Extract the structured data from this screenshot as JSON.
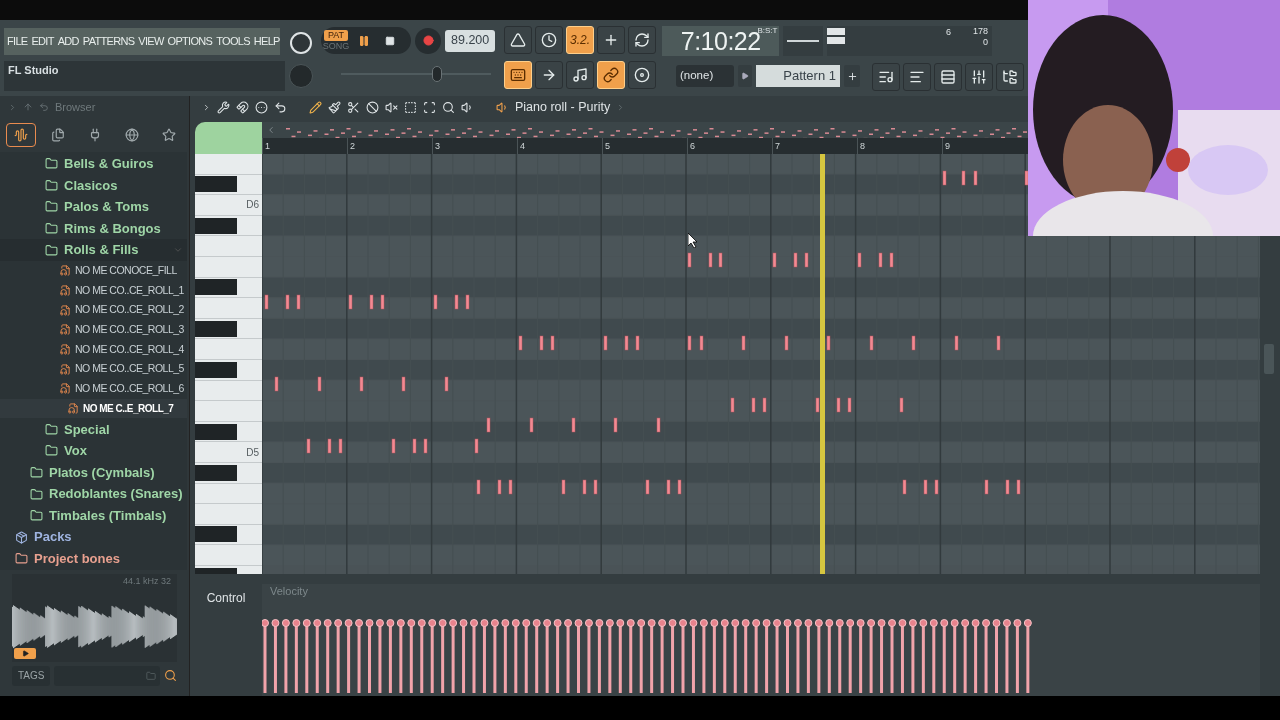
{
  "menu": [
    "FILE",
    "EDIT",
    "ADD",
    "PATTERNS",
    "VIEW",
    "OPTIONS",
    "TOOLS",
    "HELP"
  ],
  "hint": "FL Studio",
  "pitch": {
    "level": 0.65
  },
  "transport": {
    "modes": [
      {
        "label": "PAT",
        "selected": true
      },
      {
        "label": "SONG",
        "selected": false
      }
    ],
    "playing": true,
    "recording": false,
    "tempo": "89.200"
  },
  "time": {
    "value": "7:10:22",
    "unit": "B:S:T"
  },
  "tool_buttons_top": [
    {
      "kind": "metronome",
      "on": false
    },
    {
      "kind": "wait",
      "on": false
    },
    {
      "kind": "countdown",
      "label": "3.2.",
      "on": true
    },
    {
      "kind": "overdub",
      "on": false
    },
    {
      "kind": "loop",
      "on": false
    }
  ],
  "tool_buttons_bottom": [
    {
      "kind": "typing",
      "on": true
    },
    {
      "kind": "step",
      "on": false
    },
    {
      "kind": "note",
      "on": false
    },
    {
      "kind": "link",
      "on": true
    },
    {
      "kind": "knob",
      "on": false
    }
  ],
  "pattern_picker": {
    "arrangement": "(none)",
    "pattern": "Pattern 1"
  },
  "readouts": [
    "6",
    "178",
    "0"
  ],
  "window_buttons": [
    {
      "kind": "playlist"
    },
    {
      "kind": "piano_roll"
    },
    {
      "kind": "channel_rack"
    },
    {
      "kind": "mixer"
    },
    {
      "kind": "browser"
    }
  ],
  "browser": {
    "title": "Browser",
    "tabs": [
      {
        "kind": "all",
        "selected": true
      },
      {
        "kind": "files",
        "selected": false
      },
      {
        "kind": "plugins",
        "selected": false
      },
      {
        "kind": "online",
        "selected": false
      },
      {
        "kind": "starred",
        "selected": false
      }
    ],
    "tree": [
      {
        "children": [
          {
            "children": [
              {
                "kind": "folder",
                "label": "Bells & Guiros",
                "expanded": false
              },
              {
                "kind": "folder",
                "label": "Clasicos",
                "expanded": false
              },
              {
                "kind": "folder",
                "label": "Palos & Toms",
                "expanded": false
              },
              {
                "kind": "folder",
                "label": "Rims & Bongos",
                "expanded": false
              },
              {
                "kind": "folder",
                "label": "Rolls & Fills",
                "expanded": true,
                "children": [
                  {
                    "kind": "file",
                    "label": "NO ME CONOCE_FILL",
                    "selected": false
                  },
                  {
                    "kind": "file",
                    "label": "NO ME CO..CE_ROLL_1",
                    "selected": false
                  },
                  {
                    "kind": "file",
                    "label": "NO ME CO..CE_ROLL_2",
                    "selected": false
                  },
                  {
                    "kind": "file",
                    "label": "NO ME CO..CE_ROLL_3",
                    "selected": false
                  },
                  {
                    "kind": "file",
                    "label": "NO ME CO..CE_ROLL_4",
                    "selected": false
                  },
                  {
                    "kind": "file",
                    "label": "NO ME CO..CE_ROLL_5",
                    "selected": false
                  },
                  {
                    "kind": "file",
                    "label": "NO ME CO..CE_ROLL_6",
                    "selected": false
                  },
                  {
                    "kind": "file",
                    "label": "NO ME C..E_ROLL_7",
                    "selected": true
                  }
                ]
              },
              {
                "kind": "folder",
                "label": "Special",
                "expanded": false
              },
              {
                "kind": "folder",
                "label": "Vox",
                "expanded": false
              }
            ]
          },
          {
            "kind": "folder",
            "label": "Platos (Cymbals)",
            "expanded": false
          },
          {
            "kind": "folder",
            "label": "Redoblantes (Snares)",
            "expanded": false
          },
          {
            "kind": "folder",
            "label": "Timbales (Timbals)",
            "expanded": false
          }
        ]
      },
      {
        "kind": "packs",
        "label": "Packs",
        "expanded": false
      },
      {
        "kind": "project",
        "label": "Project bones",
        "expanded": false
      }
    ],
    "preview": {
      "info": "44.1 kHz 32"
    },
    "tags": "TAGS"
  },
  "piano_roll": {
    "title": "Piano roll - Purity",
    "bars": [
      "1",
      "2",
      "3",
      "4",
      "5",
      "6",
      "7",
      "8",
      "9"
    ],
    "keys": [
      "D6",
      "D5"
    ],
    "control": {
      "label": "Control",
      "target": "Velocity"
    }
  },
  "webcam": {
    "kind": "picture"
  }
}
